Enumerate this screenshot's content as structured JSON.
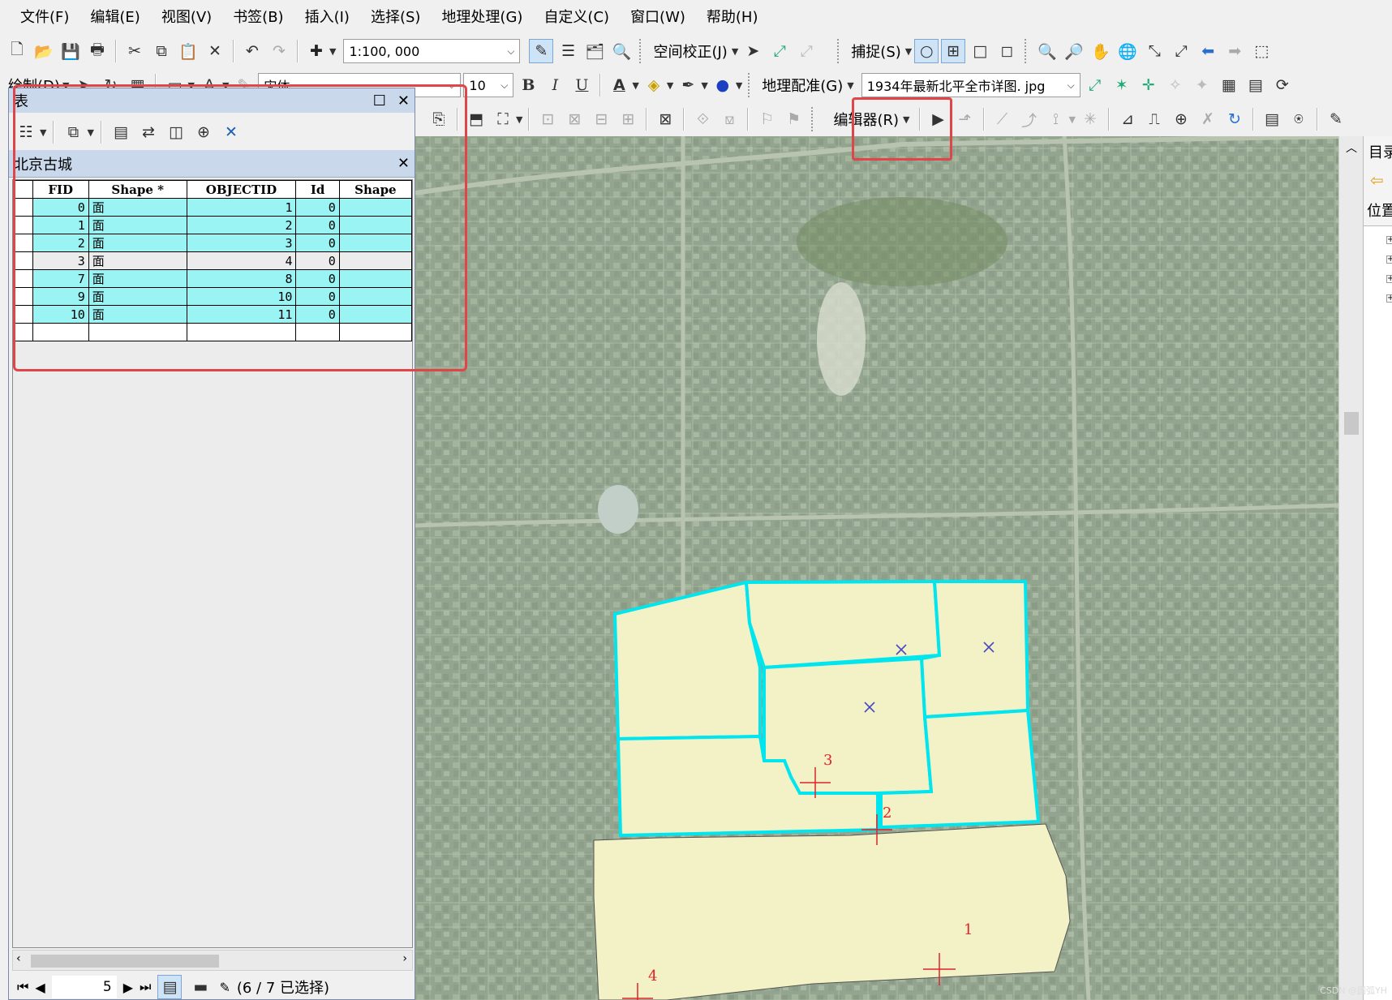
{
  "menubar": {
    "items": [
      "文件(F)",
      "编辑(E)",
      "视图(V)",
      "书签(B)",
      "插入(I)",
      "选择(S)",
      "地理处理(G)",
      "自定义(C)",
      "窗口(W)",
      "帮助(H)"
    ]
  },
  "toolbar1": {
    "scale_value": "1:100, 000",
    "spatial_adjust_label": "空间校正(J)",
    "snapping_label": "捕捉(S)"
  },
  "toolbar2": {
    "drawing_label": "绘制(D)",
    "font_value": "宋体",
    "font_size_value": "10",
    "bold_label": "B",
    "italic_label": "I",
    "underline_label": "U",
    "georef_label": "地理配准(G)",
    "georef_layer_value": "1934年最新北平全市详图. jpg"
  },
  "toolbar3": {
    "editor_label": "编辑器(R)"
  },
  "table_window": {
    "title": "表",
    "tab_label": "北京古城",
    "columns": [
      "FID",
      "Shape *",
      "OBJECTID",
      "Id",
      "Shape"
    ],
    "rows": [
      {
        "fid": "0",
        "shape": "面",
        "objectid": "1",
        "id": "0"
      },
      {
        "fid": "1",
        "shape": "面",
        "objectid": "2",
        "id": "0"
      },
      {
        "fid": "2",
        "shape": "面",
        "objectid": "3",
        "id": "0"
      },
      {
        "fid": "3",
        "shape": "面",
        "objectid": "4",
        "id": "0"
      },
      {
        "fid": "7",
        "shape": "面",
        "objectid": "8",
        "id": "0"
      },
      {
        "fid": "9",
        "shape": "面",
        "objectid": "10",
        "id": "0"
      },
      {
        "fid": "10",
        "shape": "面",
        "objectid": "11",
        "id": "0"
      }
    ],
    "selected_rows": [
      true,
      true,
      true,
      false,
      true,
      true,
      true
    ],
    "record_number": "5",
    "selection_status": "(6 / 7 已选择)"
  },
  "map": {
    "point_labels": [
      "1",
      "2",
      "3",
      "4"
    ]
  },
  "right_pane": {
    "title": "目录",
    "location_label": "位置"
  },
  "watermark": "CSDN @圆弧YH",
  "colors": {
    "selection_cyan": "#00e5ee",
    "polygon_fill": "#f2f2c6",
    "table_selected": "#9af4f4",
    "highlight_red": "#e0454a"
  }
}
